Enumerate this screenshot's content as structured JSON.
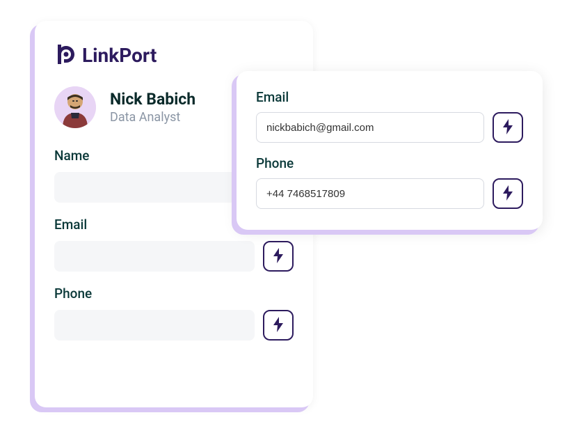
{
  "brand": {
    "name": "LinkPort"
  },
  "profile": {
    "name": "Nick Babich",
    "role": "Data Analyst"
  },
  "mainForm": {
    "nameLabel": "Name",
    "nameValue": "",
    "emailLabel": "Email",
    "emailValue": "",
    "phoneLabel": "Phone",
    "phoneValue": ""
  },
  "overlayForm": {
    "emailLabel": "Email",
    "emailValue": "nickbabich@gmail.com",
    "phoneLabel": "Phone",
    "phoneValue": "+44 7468517809"
  },
  "colors": {
    "brandDark": "#2d1b5e",
    "accentLight": "#d9c8f5",
    "textDark": "#0a2a2a",
    "textMuted": "#8b96a5"
  }
}
